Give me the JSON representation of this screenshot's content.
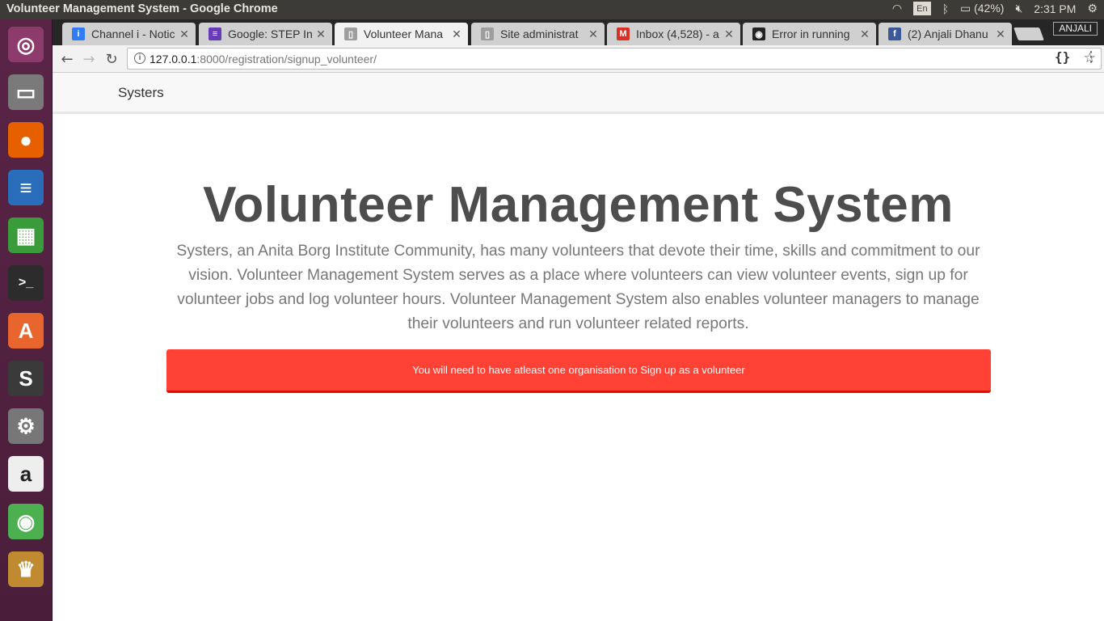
{
  "os_panel": {
    "window_title": "Volunteer Management System - Google Chrome",
    "keyboard": "En",
    "battery": "(42%)",
    "clock": "2:31 PM"
  },
  "launcher": {
    "items": [
      {
        "name": "ubuntu-dash-icon",
        "glyph": "◎",
        "color": "#8c3b6c"
      },
      {
        "name": "files-icon",
        "glyph": "▭",
        "color": "#7a7a7a"
      },
      {
        "name": "firefox-icon",
        "glyph": "●",
        "color": "#e66000"
      },
      {
        "name": "writer-icon",
        "glyph": "≡",
        "color": "#2a6ebb"
      },
      {
        "name": "calc-icon",
        "glyph": "▦",
        "color": "#3a9b3a"
      },
      {
        "name": "terminal-icon",
        "glyph": ">_",
        "color": "#2c2c2c"
      },
      {
        "name": "software-center-icon",
        "glyph": "A",
        "color": "#e8652d"
      },
      {
        "name": "sublime-icon",
        "glyph": "S",
        "color": "#3a3a3a"
      },
      {
        "name": "settings-icon",
        "glyph": "⚙",
        "color": "#777777"
      },
      {
        "name": "amazon-icon",
        "glyph": "a",
        "color": "#eeeeee"
      },
      {
        "name": "chrome-icon",
        "glyph": "◉",
        "color": "#4caf50"
      },
      {
        "name": "game-icon",
        "glyph": "♛",
        "color": "#c08a30"
      }
    ]
  },
  "browser": {
    "profile": "ANJALI",
    "tabs": [
      {
        "label": "Channel i - Notic",
        "fav": "i",
        "fav_color": "#2f7cf6",
        "active": false
      },
      {
        "label": "Google: STEP In",
        "fav": "≡",
        "fav_color": "#673ab7",
        "active": false
      },
      {
        "label": "Volunteer Mana",
        "fav": "▯",
        "fav_color": "#9e9e9e",
        "active": true
      },
      {
        "label": "Site administrat",
        "fav": "▯",
        "fav_color": "#9e9e9e",
        "active": false
      },
      {
        "label": "Inbox (4,528) - a",
        "fav": "M",
        "fav_color": "#d93025",
        "active": false
      },
      {
        "label": "Error in running",
        "fav": "◉",
        "fav_color": "#222222",
        "active": false
      },
      {
        "label": "(2) Anjali Dhanu",
        "fav": "f",
        "fav_color": "#3b5998",
        "active": false
      }
    ],
    "url_host": "127.0.0.1",
    "url_path": ":8000/registration/signup_volunteer/"
  },
  "page": {
    "brand": "Systers",
    "title": "Volunteer Management System",
    "description": "Systers, an Anita Borg Institute Community, has many volunteers that devote their time, skills and commitment to our vision. Volunteer Management System serves as a place where volunteers can view volunteer events, sign up for volunteer jobs and log volunteer hours. Volunteer Management System also enables volunteer managers to manage their volunteers and run volunteer related reports.",
    "alert": "You will need to have atleast one organisation to Sign up as a volunteer",
    "alert_color": "#ff4136"
  }
}
